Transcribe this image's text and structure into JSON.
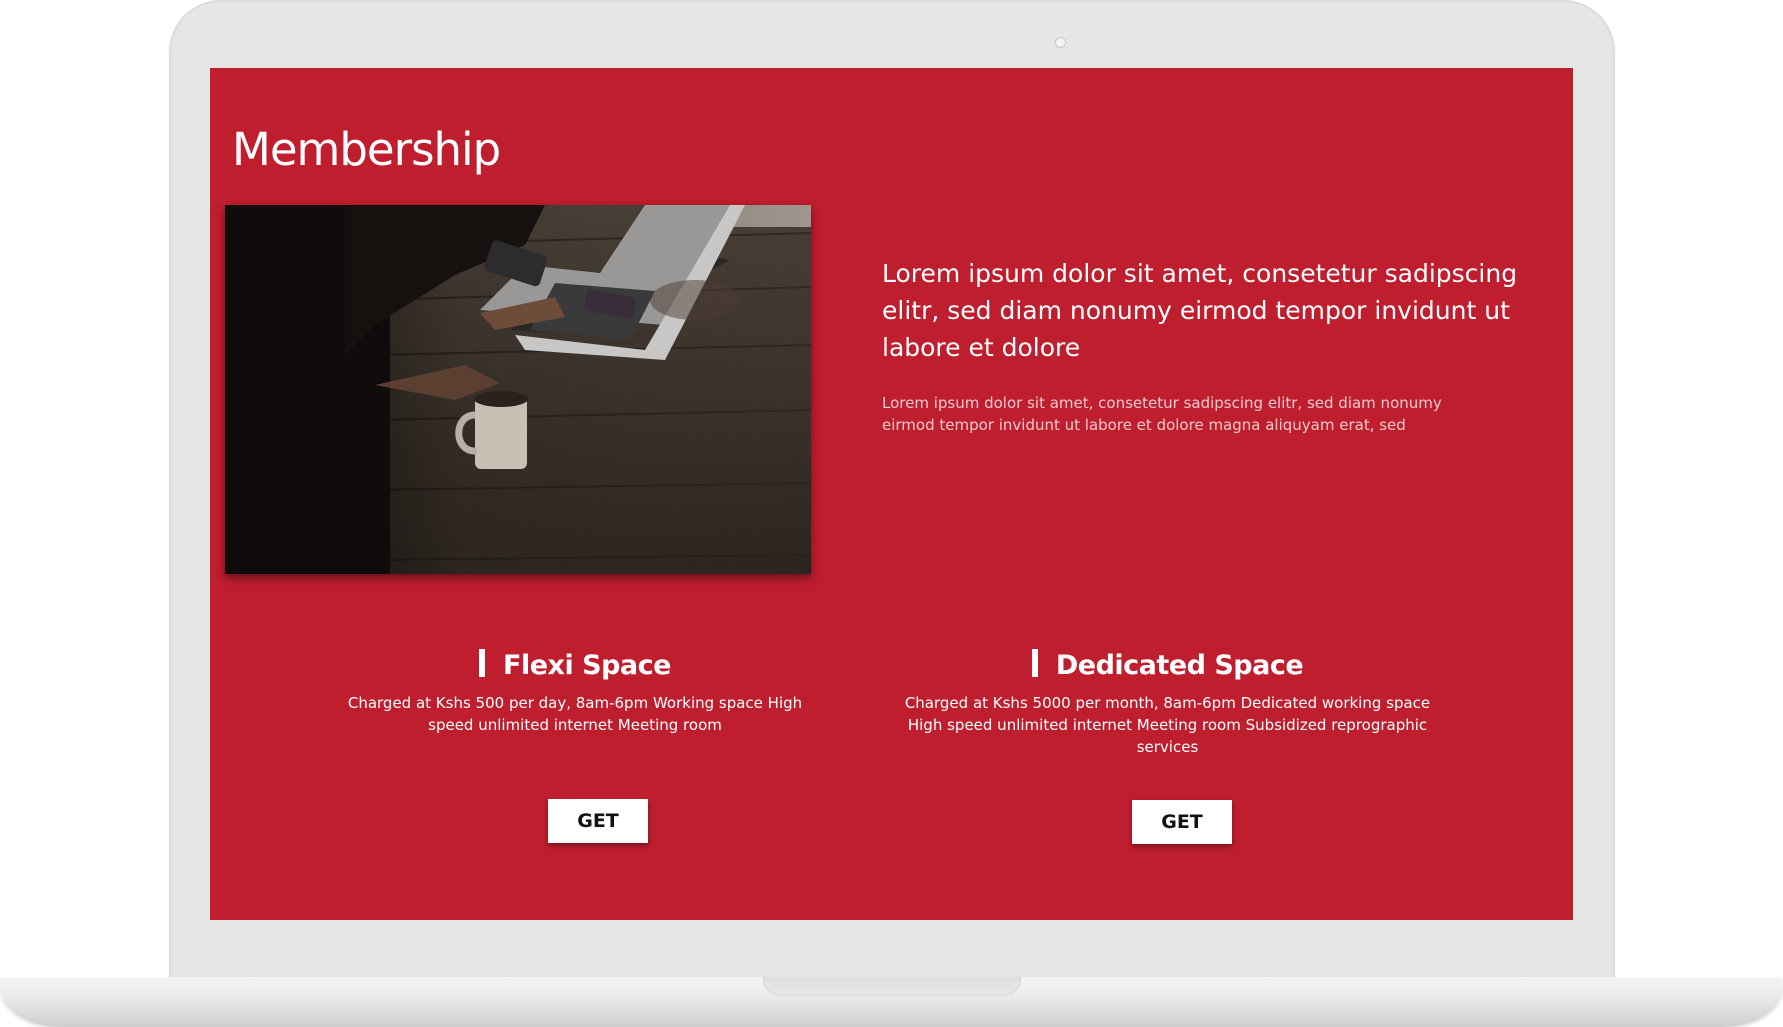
{
  "page": {
    "title": "Membership",
    "accent_color": "#be1e2e"
  },
  "intro": {
    "lead": "Lorem ipsum dolor sit amet, consetetur sadipscing elitr, sed diam nonumy eirmod tempor invidunt ut labore et dolore",
    "sub": "Lorem ipsum dolor sit amet, consetetur sadipscing elitr, sed diam nonumy eirmod tempor invidunt ut labore et dolore magna aliquyam erat, sed"
  },
  "plans": [
    {
      "title": "Flexi Space",
      "description": "Charged at Kshs 500 per day, 8am-6pm Working space High speed unlimited internet Meeting room",
      "button_label": "GET"
    },
    {
      "title": "Dedicated Space",
      "description": "Charged at Kshs 5000 per month, 8am-6pm Dedicated working space High speed unlimited internet Meeting room Subsidized reprographic services",
      "button_label": "GET"
    }
  ]
}
